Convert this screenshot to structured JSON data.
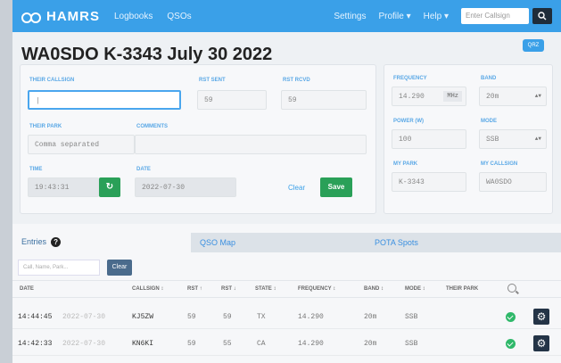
{
  "navbar": {
    "brand": "HAMRS",
    "links": [
      "Logbooks",
      "QSOs"
    ],
    "right_links": [
      "Settings",
      "Profile ▾",
      "Help ▾"
    ],
    "search_placeholder": "Enter Callsign"
  },
  "title": "WA0SDO K-3343 July 30 2022",
  "qrz_badge": "QRZ",
  "form": {
    "their_callsign": {
      "label": "THEIR CALLSIGN",
      "value": "|"
    },
    "rst_sent": {
      "label": "RST SENT",
      "value": "59"
    },
    "rst_rcvd": {
      "label": "RST RCVD",
      "value": "59"
    },
    "their_park": {
      "label": "THEIR PARK",
      "placeholder": "Comma separated"
    },
    "comments": {
      "label": "COMMENTS",
      "value": ""
    },
    "time": {
      "label": "TIME",
      "value": "19:43:31"
    },
    "now_button": "↻",
    "date": {
      "label": "DATE",
      "value": "2022-07-30"
    },
    "clear_label": "Clear",
    "save_label": "Save"
  },
  "right_form": {
    "frequency": {
      "label": "FREQUENCY",
      "value": "14.290",
      "unit": "MHz"
    },
    "band": {
      "label": "BAND",
      "value": "20m"
    },
    "power": {
      "label": "POWER (W)",
      "value": "100"
    },
    "mode": {
      "label": "MODE",
      "value": "SSB"
    },
    "my_park": {
      "label": "MY PARK",
      "value": "K-3343"
    },
    "my_callsign": {
      "label": "MY CALLSIGN",
      "value": "WA0SDO"
    }
  },
  "tabs": {
    "entries": "Entries",
    "entries_badge": "?",
    "map": "QSO Map",
    "pota": "POTA Spots"
  },
  "filter": {
    "placeholder": "Call, Name, Park...",
    "clear_label": "Clear"
  },
  "table": {
    "headers": [
      "DATE",
      "CALLSIGN ↕",
      "RST ↑",
      "RST ↓",
      "STATE ↕",
      "FREQUENCY ↕",
      "BAND ↕",
      "MODE ↕",
      "THEIR PARK"
    ],
    "rows": [
      {
        "time": "14:44:45",
        "date": "2022-07-30",
        "callsign": "KJ5ZW",
        "rst_sent": "59",
        "rst_rcvd": "59",
        "state": "TX",
        "frequency": "14.290",
        "band": "20m",
        "mode": "SSB",
        "park": ""
      },
      {
        "time": "14:42:33",
        "date": "2022-07-30",
        "callsign": "KN6KI",
        "rst_sent": "59",
        "rst_rcvd": "55",
        "state": "CA",
        "frequency": "14.290",
        "band": "20m",
        "mode": "SSB",
        "park": ""
      }
    ]
  },
  "colors": {
    "accent": "#3aa0e8",
    "save": "#2aa058",
    "navbar": "#3aa0e8"
  }
}
